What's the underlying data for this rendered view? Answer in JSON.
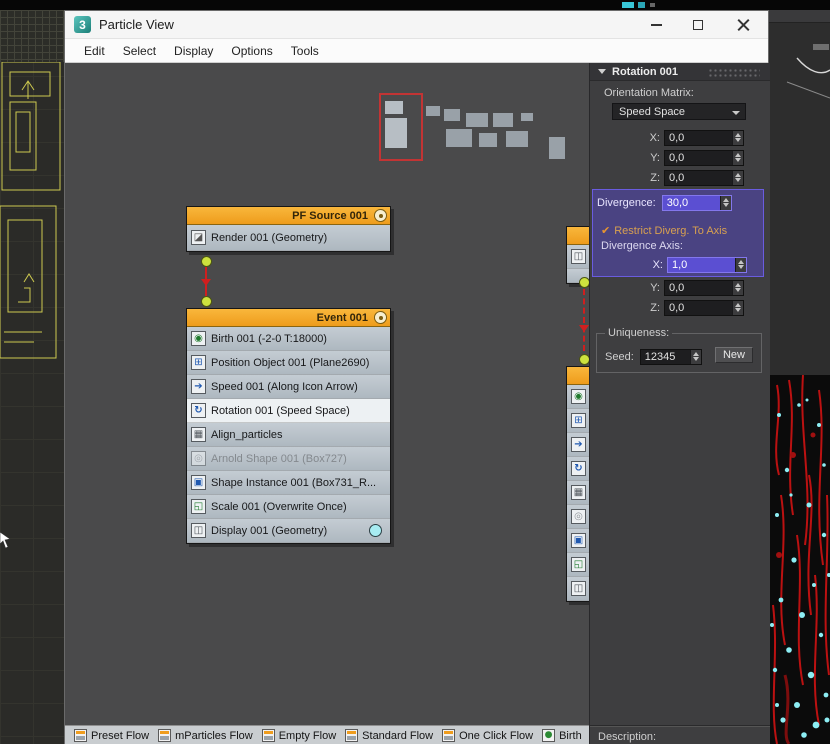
{
  "window": {
    "logo": "3",
    "title": "Particle View",
    "menus": [
      "Edit",
      "Select",
      "Display",
      "Options",
      "Tools"
    ]
  },
  "canvas": {
    "pf_source": {
      "title": "PF Source 001",
      "items": [
        {
          "icon": "render-icon",
          "label": "Render 001 (Geometry)"
        }
      ]
    },
    "event": {
      "title": "Event 001",
      "items": [
        {
          "icon": "birth-icon",
          "label": "Birth 001 (-2-0 T:18000)"
        },
        {
          "icon": "position-object-icon",
          "label": "Position Object 001 (Plane2690)"
        },
        {
          "icon": "speed-icon",
          "label": "Speed 001 (Along Icon Arrow)"
        },
        {
          "icon": "rotation-icon",
          "label": "Rotation 001 (Speed Space)",
          "state": "selected"
        },
        {
          "icon": "align-icon",
          "label": "Align_particles"
        },
        {
          "icon": "arnold-shape-icon",
          "label": "Arnold Shape 001 (Box727)",
          "state": "disabled"
        },
        {
          "icon": "shape-instance-icon",
          "label": "Shape Instance 001 (Box731_R..."
        },
        {
          "icon": "scale-icon",
          "label": "Scale 001 (Overwrite Once)"
        },
        {
          "icon": "display-icon",
          "label": "Display 001 (Geometry)",
          "swatch": "#a7ecf2"
        }
      ]
    }
  },
  "panel": {
    "title": "Rotation 001",
    "orientation_matrix_label": "Orientation Matrix:",
    "orientation_value": "Speed Space",
    "euler": [
      {
        "label": "X:",
        "value": "0,0"
      },
      {
        "label": "Y:",
        "value": "0,0"
      },
      {
        "label": "Z:",
        "value": "0,0"
      }
    ],
    "divergence_label": "Divergence:",
    "divergence_value": "30,0",
    "restrict_checkbox_label": "Restrict Diverg. To Axis",
    "restrict_checked": true,
    "divergence_axis_label": "Divergence Axis:",
    "axis": [
      {
        "label": "X:",
        "value": "1,0",
        "highlight": true
      },
      {
        "label": "Y:",
        "value": "0,0"
      },
      {
        "label": "Z:",
        "value": "0,0"
      }
    ],
    "uniqueness_label": "Uniqueness:",
    "seed_label": "Seed:",
    "seed_value": "12345",
    "new_button_label": "New",
    "description_label": "Description:"
  },
  "depot": {
    "items": [
      "Preset Flow",
      "mParticles Flow",
      "Empty Flow",
      "Standard Flow",
      "One Click Flow",
      "Birth"
    ]
  },
  "colors": {
    "node_header_orange": "#f0a62e",
    "selection_purple": "#5b4fd2",
    "connector_red": "#cf1f1f",
    "event_dot_green": "#cde23e",
    "display_swatch_cyan": "#a7ecf2"
  }
}
